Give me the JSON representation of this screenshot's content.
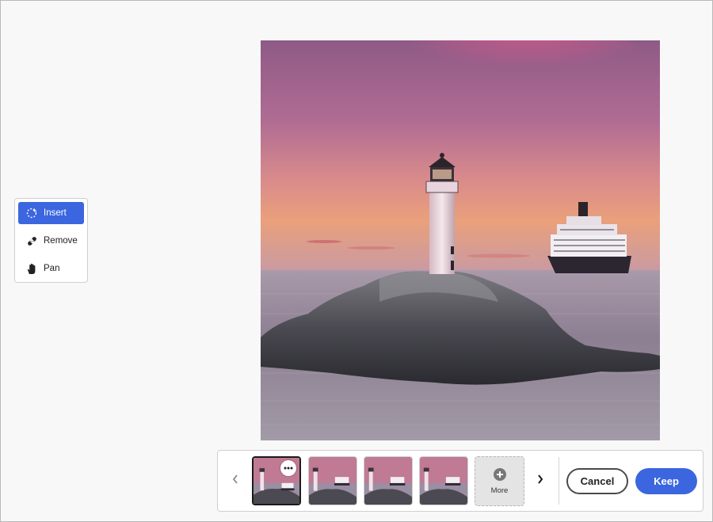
{
  "tools": {
    "items": [
      {
        "label": "Insert",
        "icon": "insert-sparkle-icon",
        "active": true
      },
      {
        "label": "Remove",
        "icon": "bandage-icon",
        "active": false
      },
      {
        "label": "Pan",
        "icon": "hand-icon",
        "active": false
      }
    ]
  },
  "canvas": {
    "subject": "lighthouse-and-cruise-ship-at-sunset"
  },
  "variations": {
    "count": 4,
    "selected_index": 0,
    "more_label": "More",
    "more_icon": "plus-circle-icon",
    "prev_icon": "chevron-left-icon",
    "next_icon": "chevron-right-icon",
    "options_icon": "ellipsis-icon"
  },
  "actions": {
    "cancel_label": "Cancel",
    "keep_label": "Keep"
  },
  "colors": {
    "accent": "#3b66df",
    "sky_top": "#9a5a8a",
    "sky_horizon": "#e49a7a",
    "sea": "#8e8196"
  }
}
